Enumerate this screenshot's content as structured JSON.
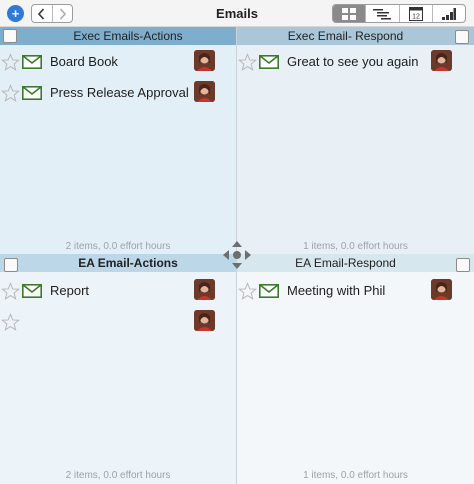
{
  "toolbar": {
    "title": "Emails",
    "add_label": "+",
    "back_icon": "chevron-left-icon",
    "forward_icon": "chevron-right-icon",
    "views": [
      {
        "icon": "grid-view-icon",
        "active": true
      },
      {
        "icon": "outline-view-icon",
        "active": false
      },
      {
        "icon": "calendar-view-icon",
        "active": false,
        "label": "12"
      },
      {
        "icon": "chart-view-icon",
        "active": false
      }
    ]
  },
  "quadrants": [
    {
      "title": "Exec Emails-Actions",
      "footer": "2 items, 0.0 effort hours",
      "items": [
        {
          "label": "Board Book",
          "has_mail": true
        },
        {
          "label": "Press Release Approval",
          "has_mail": true
        }
      ]
    },
    {
      "title": "Exec Email- Respond",
      "footer": "1 items, 0.0 effort hours",
      "items": [
        {
          "label": "Great to see you again",
          "has_mail": true
        }
      ]
    },
    {
      "title": "EA Email-Actions",
      "footer": "2 items, 0.0 effort hours",
      "items": [
        {
          "label": "Report",
          "has_mail": true
        },
        {
          "label": "",
          "has_mail": false
        }
      ]
    },
    {
      "title": "EA Email-Respond",
      "footer": "1 items, 0.0 effort hours",
      "items": [
        {
          "label": "Meeting with Phil",
          "has_mail": true
        }
      ]
    }
  ],
  "colors": {
    "accent": "#2f7ad6",
    "mail_icon": "#3a7a2a",
    "q1_header": "#7faecd",
    "q2_header": "#a9c7d8",
    "q3_header": "#bcd7e8",
    "q4_header": "#d6e7ee"
  }
}
